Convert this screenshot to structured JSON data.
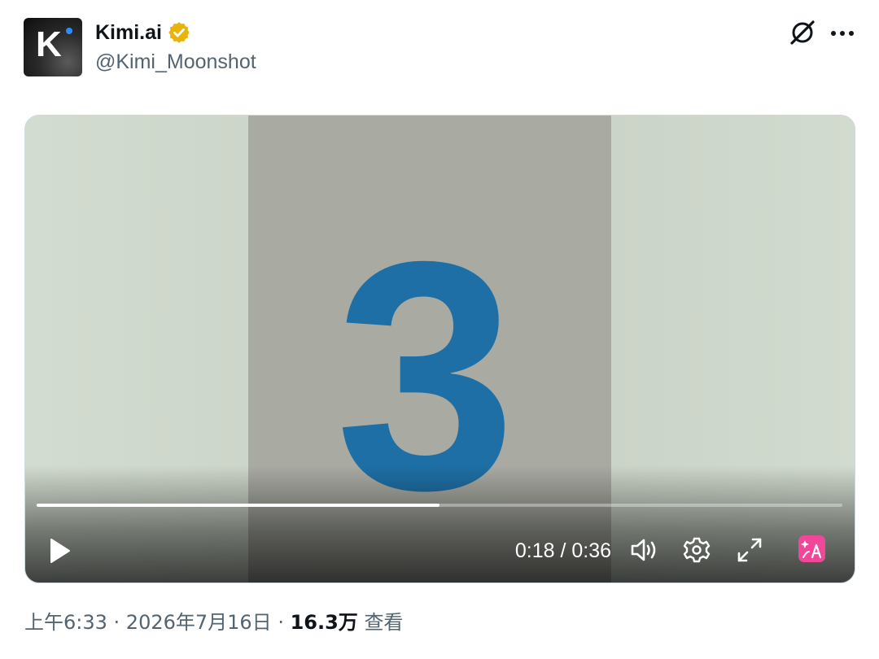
{
  "author": {
    "display_name": "Kimi.ai",
    "handle": "@Kimi_Moonshot",
    "avatar_letter": "K",
    "verified": true,
    "verified_badge_color": "#f4b400"
  },
  "header_actions": {
    "grok_icon": "grok-slash-icon",
    "more_icon": "more-horizontal-icon"
  },
  "video": {
    "frame_text": "3",
    "frame_text_color": "#1e6fa6",
    "progress_fraction": 0.5,
    "time_current": "0:18",
    "time_separator": "/",
    "time_total": "0:36",
    "time_display": "0:18 / 0:36",
    "controls": {
      "play_icon": "play-icon",
      "volume_icon": "volume-icon",
      "settings_icon": "gear-icon",
      "fullscreen_icon": "expand-icon",
      "translate_icon": "translate-icon",
      "translate_color": "#f0479a"
    }
  },
  "meta": {
    "time": "上午6:33",
    "separator": " · ",
    "date": "2026年7月16日",
    "views_count": "16.3万",
    "views_label": "查看"
  }
}
